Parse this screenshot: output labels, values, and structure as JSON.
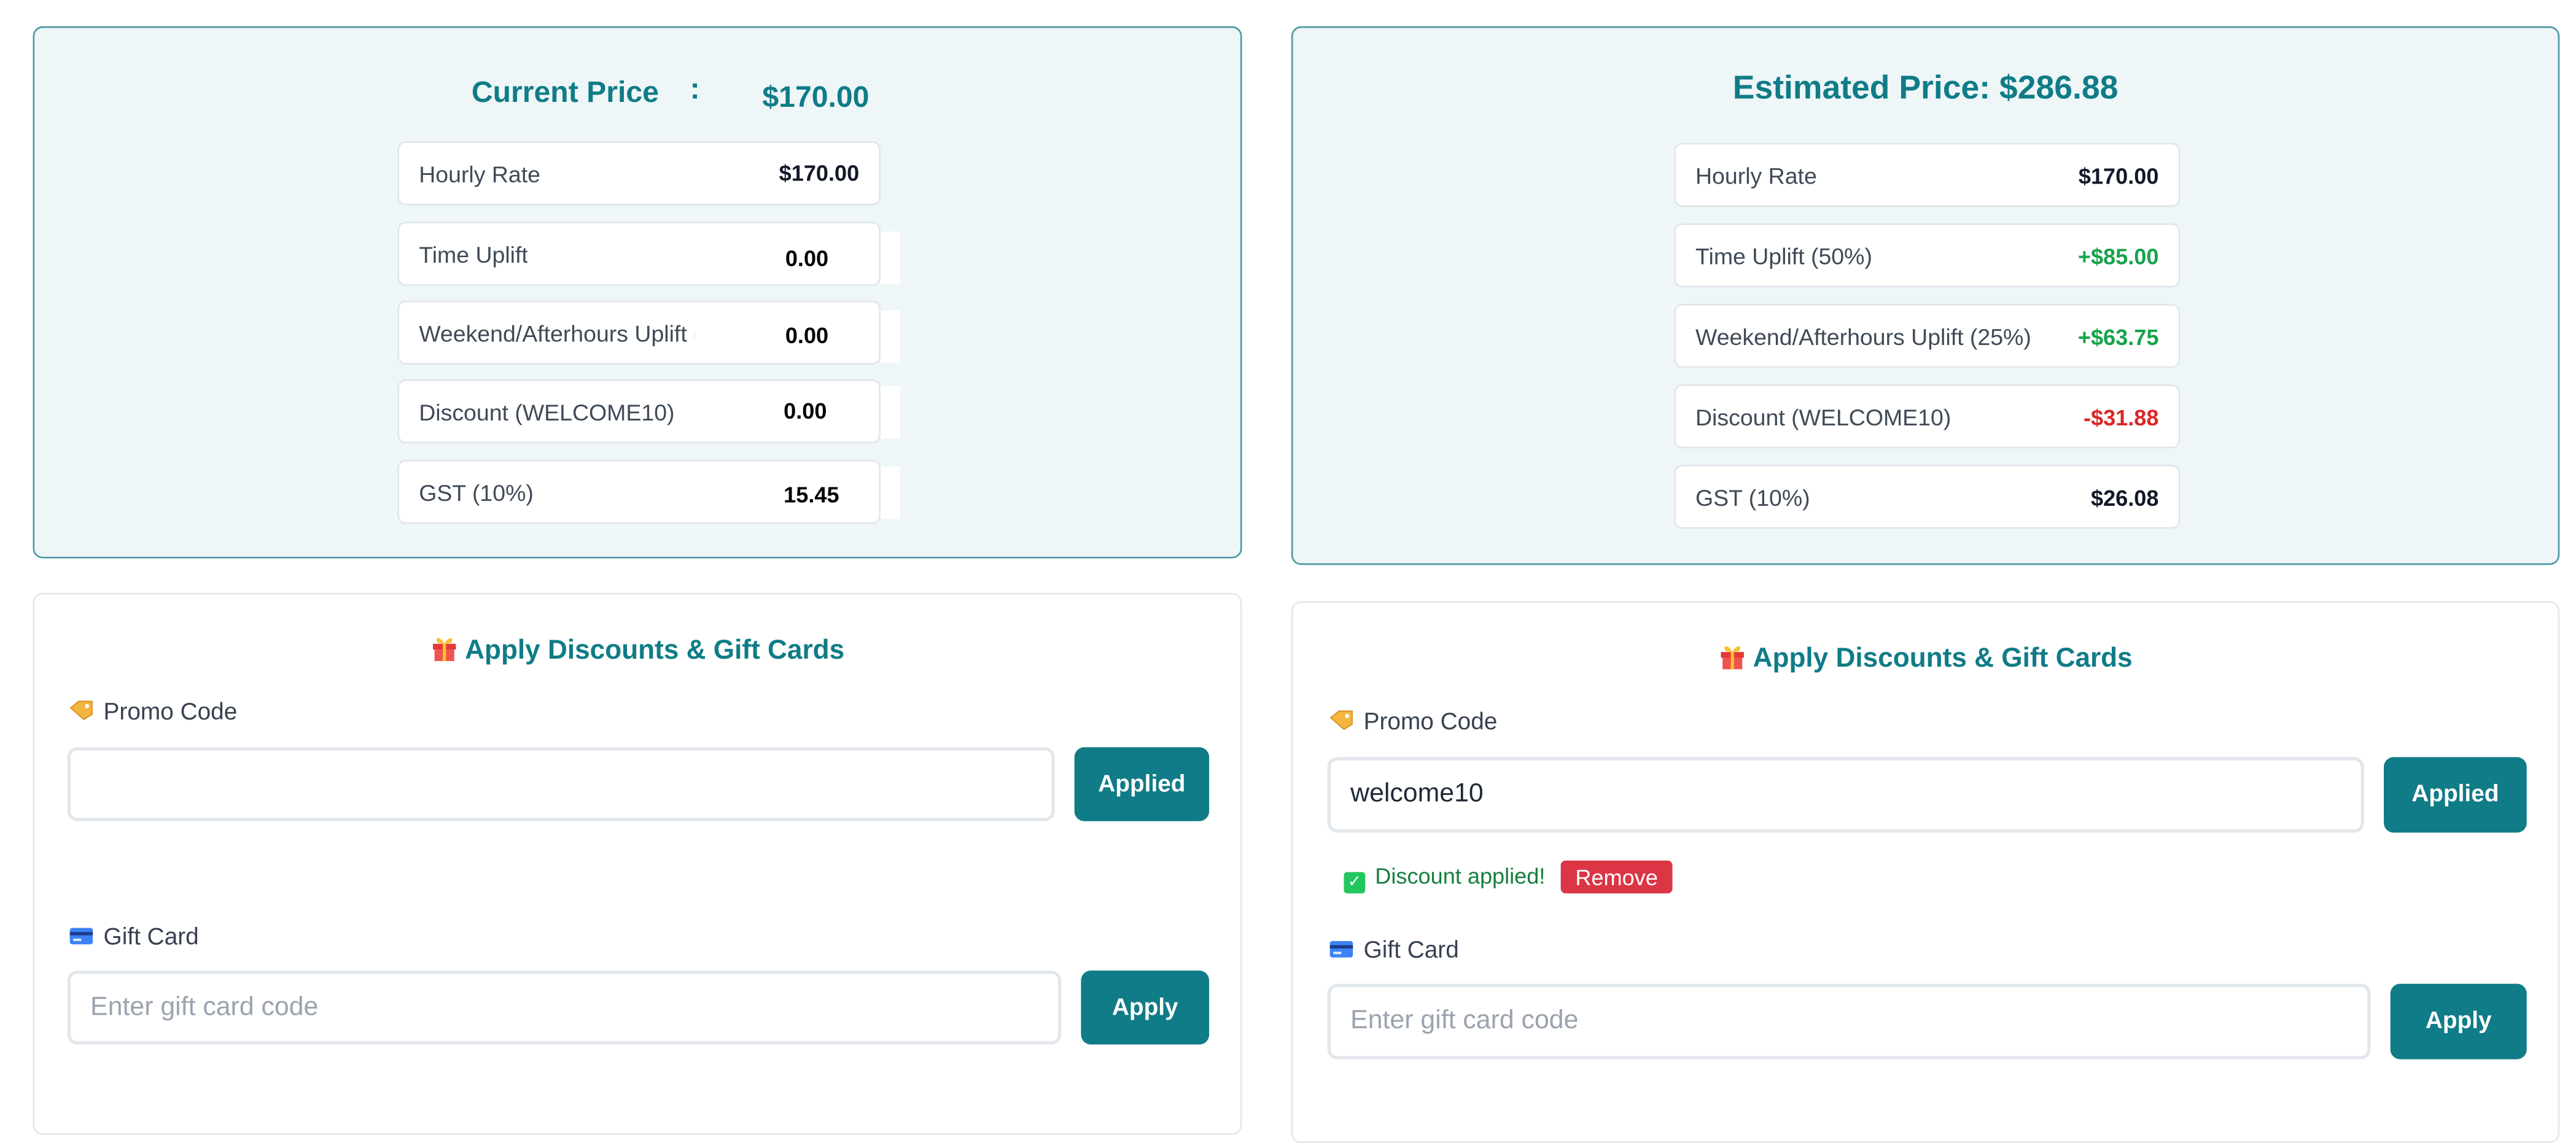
{
  "left": {
    "price_card": {
      "title": "Current Price",
      "separator": ":",
      "amount": "$170.00",
      "rows": [
        {
          "label": "Hourly Rate",
          "value": "$170.00"
        },
        {
          "label": "Time Uplift",
          "value": "0.00"
        },
        {
          "label": "Weekend/Afterhours Uplift (",
          "value": "0.00"
        },
        {
          "label": "Discount (WELCOME10)",
          "value": "0.00"
        },
        {
          "label": "GST (10%)",
          "value": "15.45"
        }
      ]
    },
    "discounts": {
      "title": "Apply Discounts & Gift Cards",
      "promo_label": "Promo Code",
      "promo_value": "",
      "promo_placeholder": "",
      "promo_button": "Applied",
      "gift_label": "Gift Card",
      "gift_placeholder": "Enter gift card code",
      "gift_button": "Apply"
    }
  },
  "right": {
    "price_card": {
      "title": "Estimated Price: $286.88",
      "rows": [
        {
          "label": "Hourly Rate",
          "value": "$170.00",
          "tone": "neutral"
        },
        {
          "label": "Time Uplift (50%)",
          "value": "+$85.00",
          "tone": "positive"
        },
        {
          "label": "Weekend/Afterhours Uplift (25%)",
          "value": "+$63.75",
          "tone": "positive"
        },
        {
          "label": "Discount (WELCOME10)",
          "value": "-$31.88",
          "tone": "negative"
        },
        {
          "label": "GST (10%)",
          "value": "$26.08",
          "tone": "neutral"
        }
      ]
    },
    "discounts": {
      "title": "Apply Discounts & Gift Cards",
      "promo_label": "Promo Code",
      "promo_value": "welcome10",
      "promo_button": "Applied",
      "status_text": "Discount applied!",
      "remove_button": "Remove",
      "gift_label": "Gift Card",
      "gift_placeholder": "Enter gift card code",
      "gift_button": "Apply"
    }
  },
  "colors": {
    "accent": "#0f7c87",
    "positive": "#16a34a",
    "negative": "#dc2626",
    "remove": "#dc3545",
    "card_tint": "#eef6f8"
  },
  "icons": {
    "section": "gift-icon",
    "promo": "tag-icon",
    "gift_card": "credit-card-icon",
    "status": "check-icon"
  }
}
